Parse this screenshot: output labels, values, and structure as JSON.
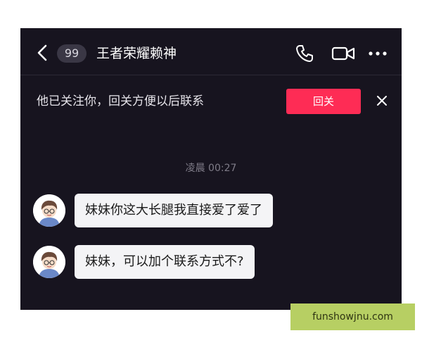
{
  "header": {
    "back_icon": "chevron-left-icon",
    "unread_count": "99",
    "contact_name": "王者荣耀赖神",
    "phone_icon": "phone-icon",
    "video_icon": "video-camera-icon",
    "more_icon": "more-dots-icon"
  },
  "follow_bar": {
    "text": "他已关注你，回关方便以后联系",
    "button_label": "回关",
    "button_color": "#fe2c55",
    "close_icon": "close-icon"
  },
  "chat": {
    "timestamp": "凌晨 00:27",
    "messages": [
      {
        "text": "妹妹你这大长腿我直接爱了爱了"
      },
      {
        "text": "妹妹，可以加个联系方式不?"
      }
    ]
  },
  "watermark": {
    "text": "funshowjnu.com",
    "color": "#b7cf63"
  },
  "colors": {
    "background": "#17141f",
    "bubble": "#f4f4f6",
    "accent": "#fe2c55"
  }
}
